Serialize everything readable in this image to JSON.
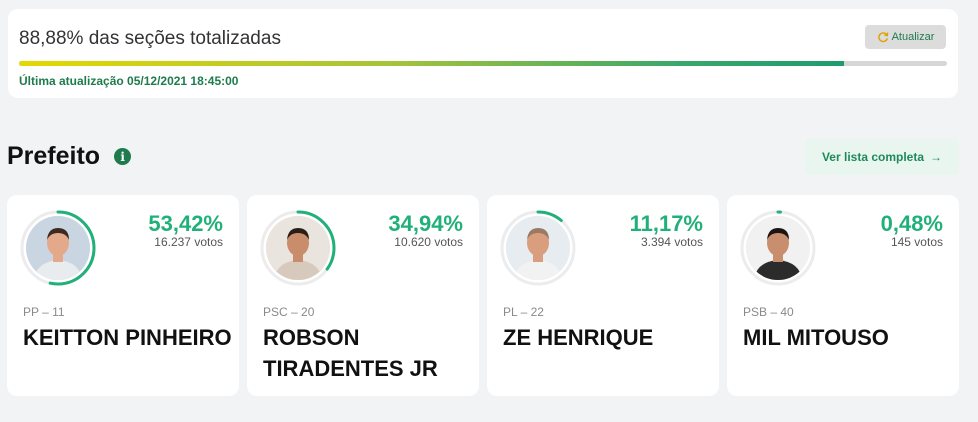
{
  "status": {
    "title": "88,88% das seções totalizadas",
    "refresh_label": "Atualizar",
    "progress": 0.8888,
    "updated": "Última atualização 05/12/2021 18:45:00"
  },
  "section": {
    "title": "Prefeito",
    "info_icon": "i",
    "full_list_label": "Ver lista completa",
    "arrow": "→"
  },
  "colors": {
    "accent": "#21b07a",
    "dark_green": "#1e7b4d",
    "ring_track": "#ececec"
  },
  "candidates": [
    {
      "party": "PP – 11",
      "name": "KEITTON PINHEIRO",
      "pct": "53,42%",
      "votes": "16.237 votos",
      "share": 0.5342,
      "shirt": "#e8ecef",
      "skin": "#e4a98a",
      "hair": "#3b2a22",
      "bg": "#c9d6e2"
    },
    {
      "party": "PSC – 20",
      "name": "ROBSON TIRADENTES JR",
      "pct": "34,94%",
      "votes": "10.620 votos",
      "share": 0.3494,
      "shirt": "#d8c9bd",
      "skin": "#c98d6c",
      "hair": "#2a1e18",
      "bg": "#e9e4de"
    },
    {
      "party": "PL – 22",
      "name": "ZE HENRIQUE",
      "pct": "11,17%",
      "votes": "3.394 votos",
      "share": 0.1117,
      "shirt": "#f2f2f2",
      "skin": "#d99e7e",
      "hair": "#9a7a65",
      "bg": "#e7ecf1"
    },
    {
      "party": "PSB – 40",
      "name": "MIL MITOUSO",
      "pct": "0,48%",
      "votes": "145 votos",
      "share": 0.0048,
      "shirt": "#2b2b2b",
      "skin": "#c98e6e",
      "hair": "#1d1511",
      "bg": "#f1f1f1"
    }
  ]
}
